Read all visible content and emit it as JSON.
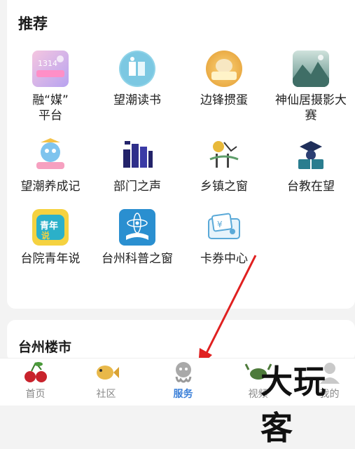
{
  "recommend": {
    "title": "推荐",
    "items": [
      {
        "label": "融“媒”\n平台",
        "icon": "rongmei-platform-icon"
      },
      {
        "label": "望潮读书",
        "icon": "book-icon"
      },
      {
        "label": "边锋掼蛋",
        "icon": "guandan-game-icon"
      },
      {
        "label": "神仙居摄影大赛",
        "icon": "mountain-photo-icon"
      },
      {
        "label": "望潮养成记",
        "icon": "mascot-icon"
      },
      {
        "label": "部门之声",
        "icon": "building-icon"
      },
      {
        "label": "乡镇之窗",
        "icon": "village-icon"
      },
      {
        "label": "台教在望",
        "icon": "education-icon"
      },
      {
        "label": "台院青年说",
        "icon": "youth-talk-icon"
      },
      {
        "label": "台州科普之窗",
        "icon": "science-icon"
      },
      {
        "label": "卡券中心",
        "icon": "coupon-icon"
      }
    ]
  },
  "loushi": {
    "title": "台州楼市"
  },
  "tabbar": {
    "tabs": [
      {
        "label": "首页",
        "icon": "cherry-icon",
        "active": false
      },
      {
        "label": "社区",
        "icon": "fish-icon",
        "active": false
      },
      {
        "label": "服务",
        "icon": "octopus-icon",
        "active": true
      },
      {
        "label": "视频",
        "icon": "crab-icon",
        "active": false
      },
      {
        "label": "我的",
        "icon": "profile-icon",
        "active": false
      }
    ]
  },
  "watermark": {
    "text": "大玩客"
  },
  "colors": {
    "active_tab": "#3a7fd8",
    "arrow": "#e02020"
  }
}
